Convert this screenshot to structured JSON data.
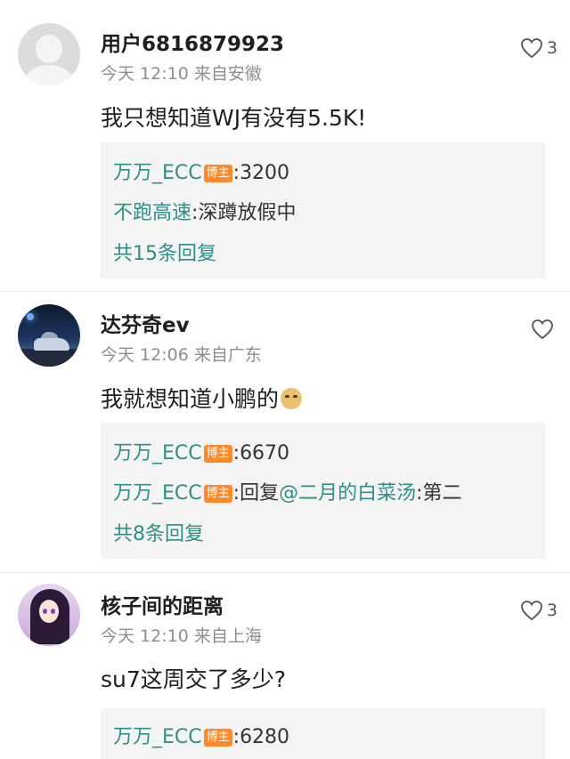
{
  "comments": [
    {
      "username": "用户6816879923",
      "time": "今天 12:10",
      "location": "来自安徽",
      "likes": "3",
      "text": "我只想知道WJ有没有5.5K!",
      "replies": [
        {
          "name": "万万_ECC",
          "badge": "博主",
          "sep": ":",
          "content": "3200"
        },
        {
          "name": "不跑高速",
          "sep": ":",
          "content": "深蹲放假中"
        }
      ],
      "more": "共15条回复"
    },
    {
      "username": "达芬奇ev",
      "time": "今天 12:06",
      "location": "来自广东",
      "likes": "",
      "text": "我就想知道小鹏的",
      "emoji": "doge-emoji",
      "replies": [
        {
          "name": "万万_ECC",
          "badge": "博主",
          "sep": ":",
          "content": "6670"
        },
        {
          "name": "万万_ECC",
          "badge": "博主",
          "sep": ":",
          "prefix": "回复",
          "mention": "@二月的白菜汤",
          "content": ":第二"
        }
      ],
      "more": "共8条回复"
    },
    {
      "username": "核子间的距离",
      "time": "今天 12:10",
      "location": "来自上海",
      "likes": "3",
      "text": "su7这周交了多少?",
      "replies": [
        {
          "name": "万万_ECC",
          "badge": "博主",
          "sep": ":",
          "content": "6280"
        }
      ]
    }
  ],
  "colors": {
    "accent": "#2f8f88",
    "badge": "#ff8a2a",
    "reply_bg": "#f4f4f4"
  }
}
